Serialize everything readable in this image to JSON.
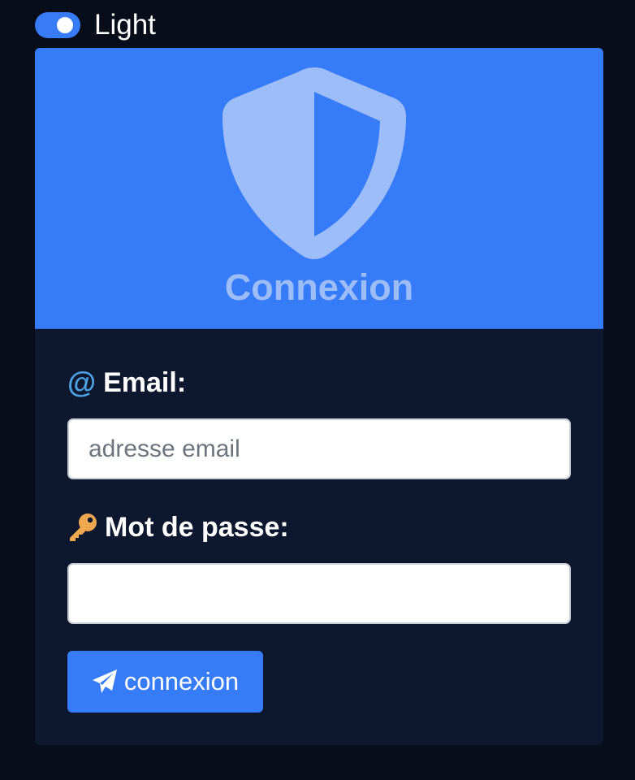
{
  "theme": {
    "label": "Light",
    "toggle_on": true
  },
  "card": {
    "title": "Connexion",
    "header_icon": "shield-icon"
  },
  "form": {
    "email": {
      "icon": "at-icon",
      "icon_glyph": "@",
      "label": "Email:",
      "placeholder": "adresse email",
      "value": ""
    },
    "password": {
      "icon": "key-icon",
      "label": "Mot de passe:",
      "value": ""
    },
    "submit": {
      "icon": "paper-plane-icon",
      "label": "connexion"
    }
  },
  "colors": {
    "page_background": "#080d1a",
    "card_body": "#0d182e",
    "accent": "#367bf7",
    "title_tint": "#9cbdf8",
    "at_icon": "#4f9fe0",
    "key_icon": "#f0a84e"
  }
}
